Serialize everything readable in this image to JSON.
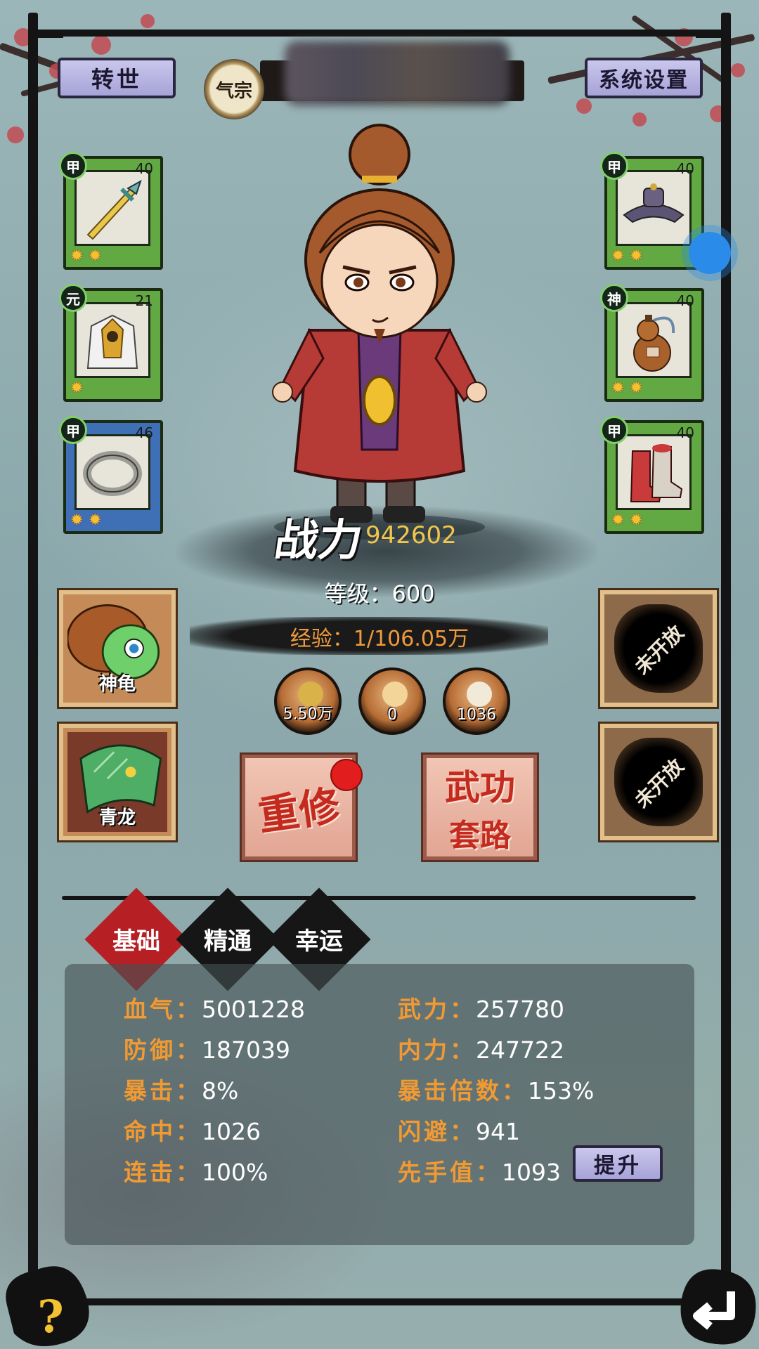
{
  "header": {
    "rebirth_label": "转世",
    "sect_label": "气宗",
    "settings_label": "系统设置"
  },
  "equipment_left": [
    {
      "grade": "甲",
      "level": "40",
      "stars": 2,
      "item": "sword"
    },
    {
      "grade": "元",
      "level": "21",
      "stars": 1,
      "item": "armor"
    },
    {
      "grade": "甲",
      "level": "46",
      "stars": 2,
      "item": "ring"
    }
  ],
  "equipment_right": [
    {
      "grade": "甲",
      "level": "40",
      "stars": 2,
      "item": "hat"
    },
    {
      "grade": "神",
      "level": "40",
      "stars": 2,
      "item": "gourd"
    },
    {
      "grade": "甲",
      "level": "40",
      "stars": 2,
      "item": "boots"
    }
  ],
  "character": {
    "power_label": "战力",
    "power_value": "942602",
    "level_text": "等级：600",
    "exp_text": "经验：1/106.05万"
  },
  "resources": [
    {
      "value": "5.50万",
      "color": "#d9b24a"
    },
    {
      "value": "0",
      "color": "#f3d59a"
    },
    {
      "value": "1036",
      "color": "#f2ead8"
    }
  ],
  "pets": [
    {
      "name": "神龟"
    },
    {
      "name": "青龙"
    }
  ],
  "locked_slots": [
    {
      "label": "未开放"
    },
    {
      "label": "未开放"
    }
  ],
  "actions": {
    "retrain_label": "重修",
    "martial_label_1": "武功",
    "martial_label_2": "套路"
  },
  "tabs": [
    {
      "label": "基础",
      "active": true
    },
    {
      "label": "精通",
      "active": false
    },
    {
      "label": "幸运",
      "active": false
    }
  ],
  "stats_left": [
    {
      "key": "血气：",
      "value": "5001228"
    },
    {
      "key": "防御：",
      "value": "187039"
    },
    {
      "key": "暴击：",
      "value": "8%"
    },
    {
      "key": "命中：",
      "value": "1026"
    },
    {
      "key": "连击：",
      "value": "100%"
    }
  ],
  "stats_right": [
    {
      "key": "武力：",
      "value": "257780"
    },
    {
      "key": "内力：",
      "value": "247722"
    },
    {
      "key": "暴击倍数：",
      "value": "153%"
    },
    {
      "key": "闪避：",
      "value": "941"
    },
    {
      "key": "先手值：",
      "value": "1093"
    }
  ],
  "upgrade_label": "提升",
  "help_label": "?",
  "colors": {
    "accent_orange": "#f29a32",
    "power_gold": "#f3c64b",
    "active_tab": "#b62024"
  }
}
